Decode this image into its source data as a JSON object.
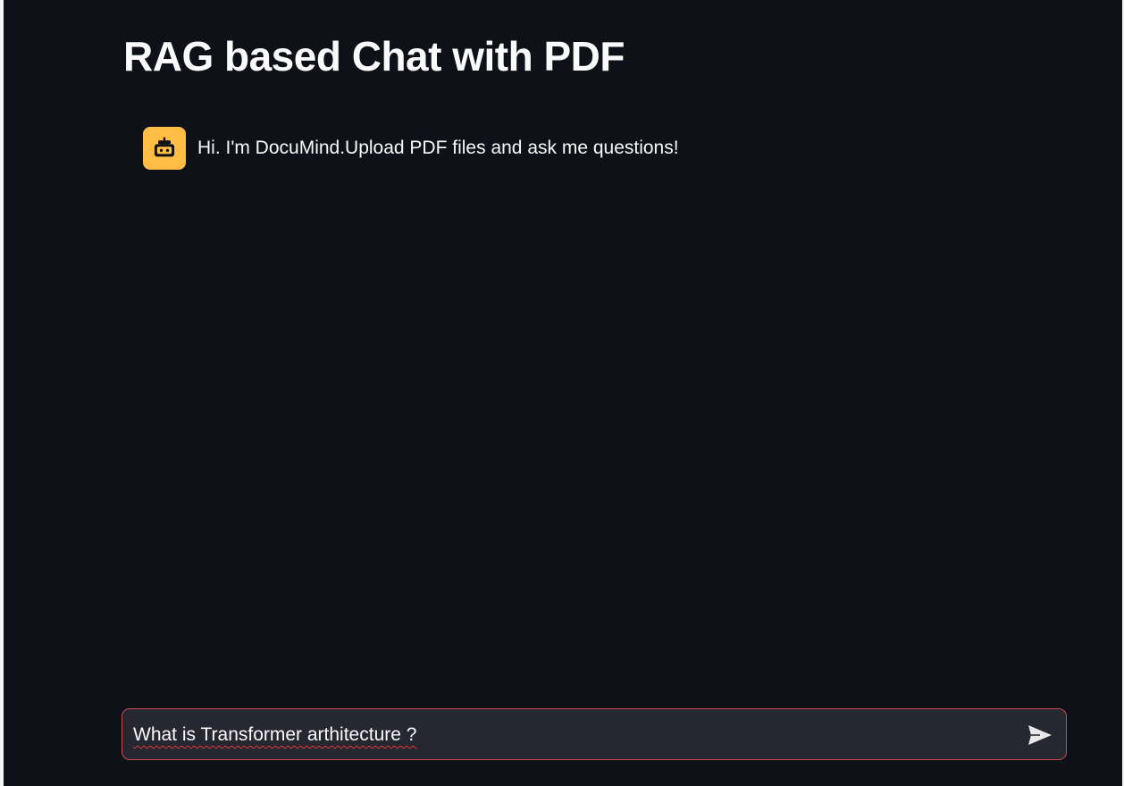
{
  "page": {
    "title": "RAG based Chat with PDF"
  },
  "chat": {
    "messages": [
      {
        "role": "assistant",
        "avatar_icon": "bot-icon",
        "text": "Hi. I'm DocuMind.Upload PDF files and ask me questions!"
      }
    ]
  },
  "input": {
    "value": "What is Transformer arthitecture ?",
    "send_icon": "send-icon"
  },
  "colors": {
    "background": "#0e1117",
    "avatar": "#ffbd45",
    "input_background": "#262730",
    "input_border": "#c84a52",
    "text": "#fafafa"
  }
}
